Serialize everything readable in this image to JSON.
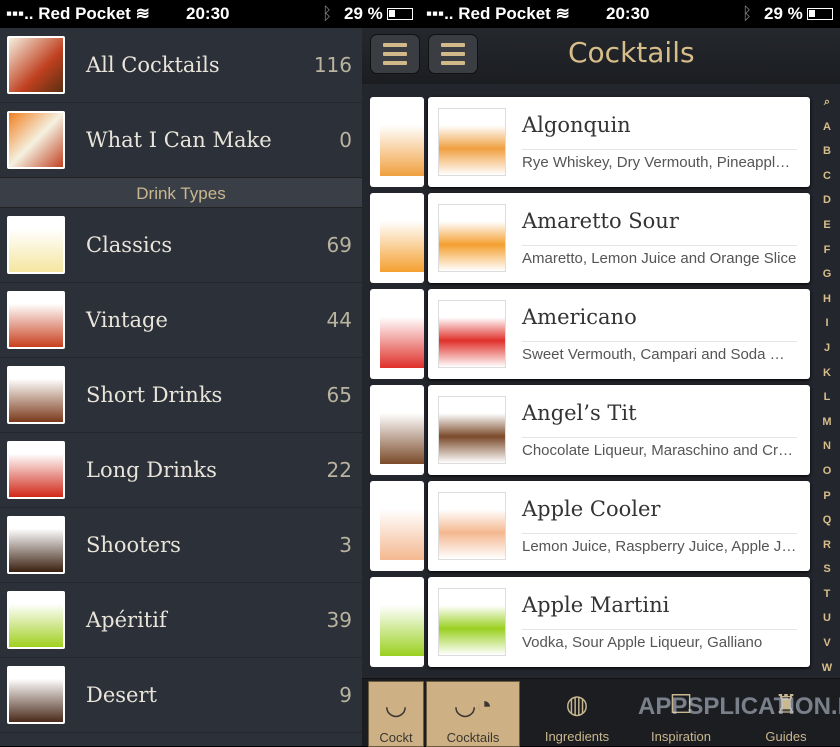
{
  "status": {
    "carrier": "Red Pocket",
    "time": "20:30",
    "battery": "29 %"
  },
  "sidebar": {
    "top": [
      {
        "label": "All Cocktails",
        "count": "116"
      },
      {
        "label": "What I Can Make",
        "count": "0"
      }
    ],
    "section": "Drink Types",
    "types": [
      {
        "label": "Classics",
        "count": "69"
      },
      {
        "label": "Vintage",
        "count": "44"
      },
      {
        "label": "Short Drinks",
        "count": "65"
      },
      {
        "label": "Long Drinks",
        "count": "22"
      },
      {
        "label": "Shooters",
        "count": "3"
      },
      {
        "label": "Apéritif",
        "count": "39"
      },
      {
        "label": "Desert",
        "count": "9"
      }
    ]
  },
  "header": {
    "title": "Cocktails"
  },
  "cocktails": [
    {
      "name": "Algonquin",
      "ingredients": "Rye Whiskey, Dry Vermouth, Pineapple Juice",
      "color": "#f0a040"
    },
    {
      "name": "Amaretto Sour",
      "ingredients": "Amaretto, Lemon Juice and Orange Slice",
      "color": "#f4a030"
    },
    {
      "name": "Americano",
      "ingredients": "Sweet Vermouth, Campari and Soda Water",
      "color": "#e0302a"
    },
    {
      "name": "Angel’s Tit",
      "ingredients": "Chocolate Liqueur, Maraschino and Cream",
      "color": "#7a4a2a"
    },
    {
      "name": "Apple Cooler",
      "ingredients": "Lemon Juice, Raspberry Juice, Apple Juice",
      "color": "#f4b890"
    },
    {
      "name": "Apple Martini",
      "ingredients": "Vodka, Sour Apple Liqueur, Galliano",
      "color": "#9ad020"
    }
  ],
  "index": [
    "Q",
    "A",
    "B",
    "C",
    "D",
    "E",
    "F",
    "G",
    "H",
    "I",
    "J",
    "K",
    "L",
    "M",
    "N",
    "O",
    "P",
    "Q",
    "R",
    "S",
    "T",
    "U",
    "V",
    "W",
    "Y",
    "Z"
  ],
  "tabs": [
    {
      "label": "Cocktails",
      "icon": "cocktail-glass-icon"
    },
    {
      "label": "Ingredients",
      "icon": "lemon-icon"
    },
    {
      "label": "Inspiration",
      "icon": "inspiration-icon"
    },
    {
      "label": "Guides",
      "icon": "shaker-icon"
    }
  ],
  "back_tab": "Cockt",
  "watermark": "APPSPLICATION.DE"
}
